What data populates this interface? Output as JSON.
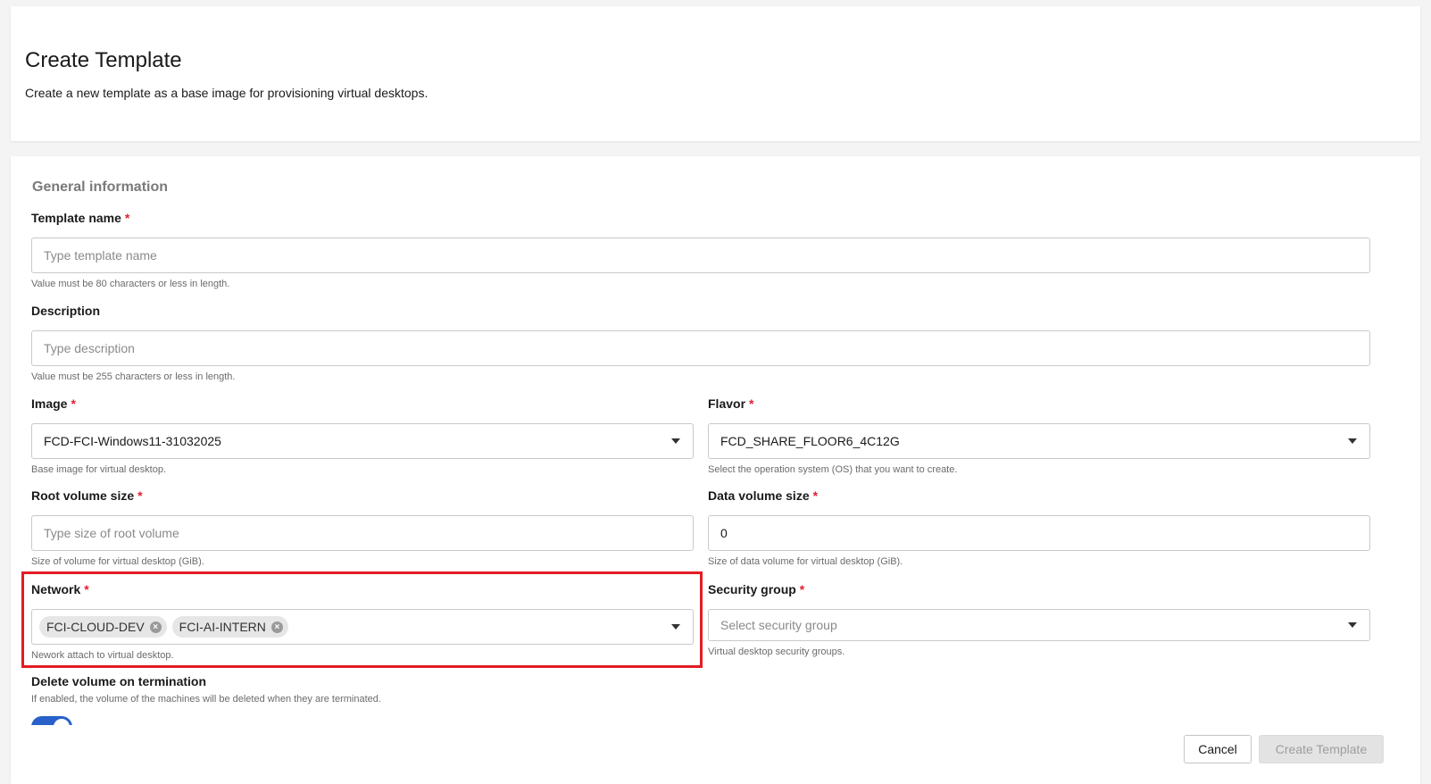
{
  "header": {
    "title": "Create Template",
    "subtitle": "Create a new template as a base image for provisioning virtual desktops."
  },
  "form": {
    "section_title": "General information",
    "template_name": {
      "label": "Template name",
      "placeholder": "Type template name",
      "hint": "Value must be 80 characters or less in length."
    },
    "description": {
      "label": "Description",
      "placeholder": "Type description",
      "hint": "Value must be 255 characters or less in length."
    },
    "image": {
      "label": "Image",
      "value": "FCD-FCI-Windows11-31032025",
      "hint": "Base image for virtual desktop."
    },
    "flavor": {
      "label": "Flavor",
      "value": "FCD_SHARE_FLOOR6_4C12G",
      "hint": "Select the operation system (OS) that you want to create."
    },
    "root_volume": {
      "label": "Root volume size",
      "placeholder": "Type size of root volume",
      "hint": "Size of volume for virtual desktop (GiB)."
    },
    "data_volume": {
      "label": "Data volume size",
      "value": "0",
      "hint": "Size of data volume for virtual desktop (GiB)."
    },
    "network": {
      "label": "Network",
      "tags": [
        "FCI-CLOUD-DEV",
        "FCI-AI-INTERN"
      ],
      "hint": "Nework attach to virtual desktop."
    },
    "security_group": {
      "label": "Security group",
      "placeholder": "Select security group",
      "hint": "Virtual desktop security groups."
    },
    "delete_volume": {
      "label": "Delete volume on termination",
      "hint": "If enabled, the volume of the machines will be deleted when they are terminated.",
      "enabled": true
    },
    "required_mark": "*"
  },
  "footer": {
    "cancel_label": "Cancel",
    "create_label": "Create Template"
  },
  "colors": {
    "accent": "#2761c9",
    "required": "#e0202f",
    "highlight": "#e41b23"
  }
}
